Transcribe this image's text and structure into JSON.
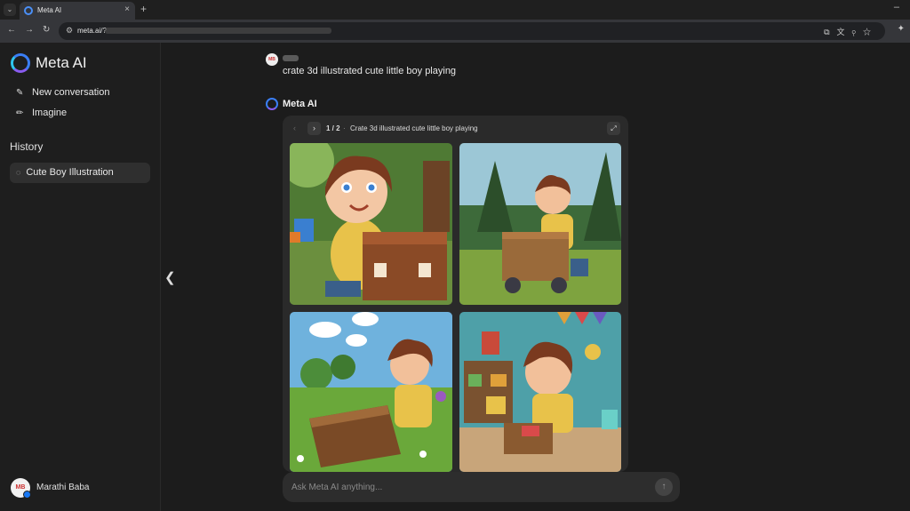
{
  "browser": {
    "tab_title": "Meta AI",
    "url": "meta.ai/?",
    "tab_close": "×",
    "new_tab": "+",
    "minimize": "–"
  },
  "sidebar": {
    "brand": "Meta AI",
    "items": [
      {
        "label": "New conversation",
        "icon": "edit-icon"
      },
      {
        "label": "Imagine",
        "icon": "pencil-icon"
      }
    ],
    "history_title": "History",
    "history": [
      {
        "label": "Cute Boy Illustration",
        "icon": "chat-bubble-icon"
      }
    ],
    "user": {
      "name": "Marathi Baba"
    }
  },
  "chat": {
    "user_message": "crate 3d illustrated cute little boy playing",
    "ai_name": "Meta AI",
    "result": {
      "page": "1 / 2",
      "separator": "·",
      "title": "Crate 3d illustrated cute little boy playing",
      "image_count": 4
    }
  },
  "composer": {
    "placeholder": "Ask Meta AI anything..."
  },
  "colors": {
    "background": "#1c1c1c",
    "sidebar": "#1e1e1e",
    "card": "#2a2a2a",
    "accent": "#3a7ef5"
  }
}
